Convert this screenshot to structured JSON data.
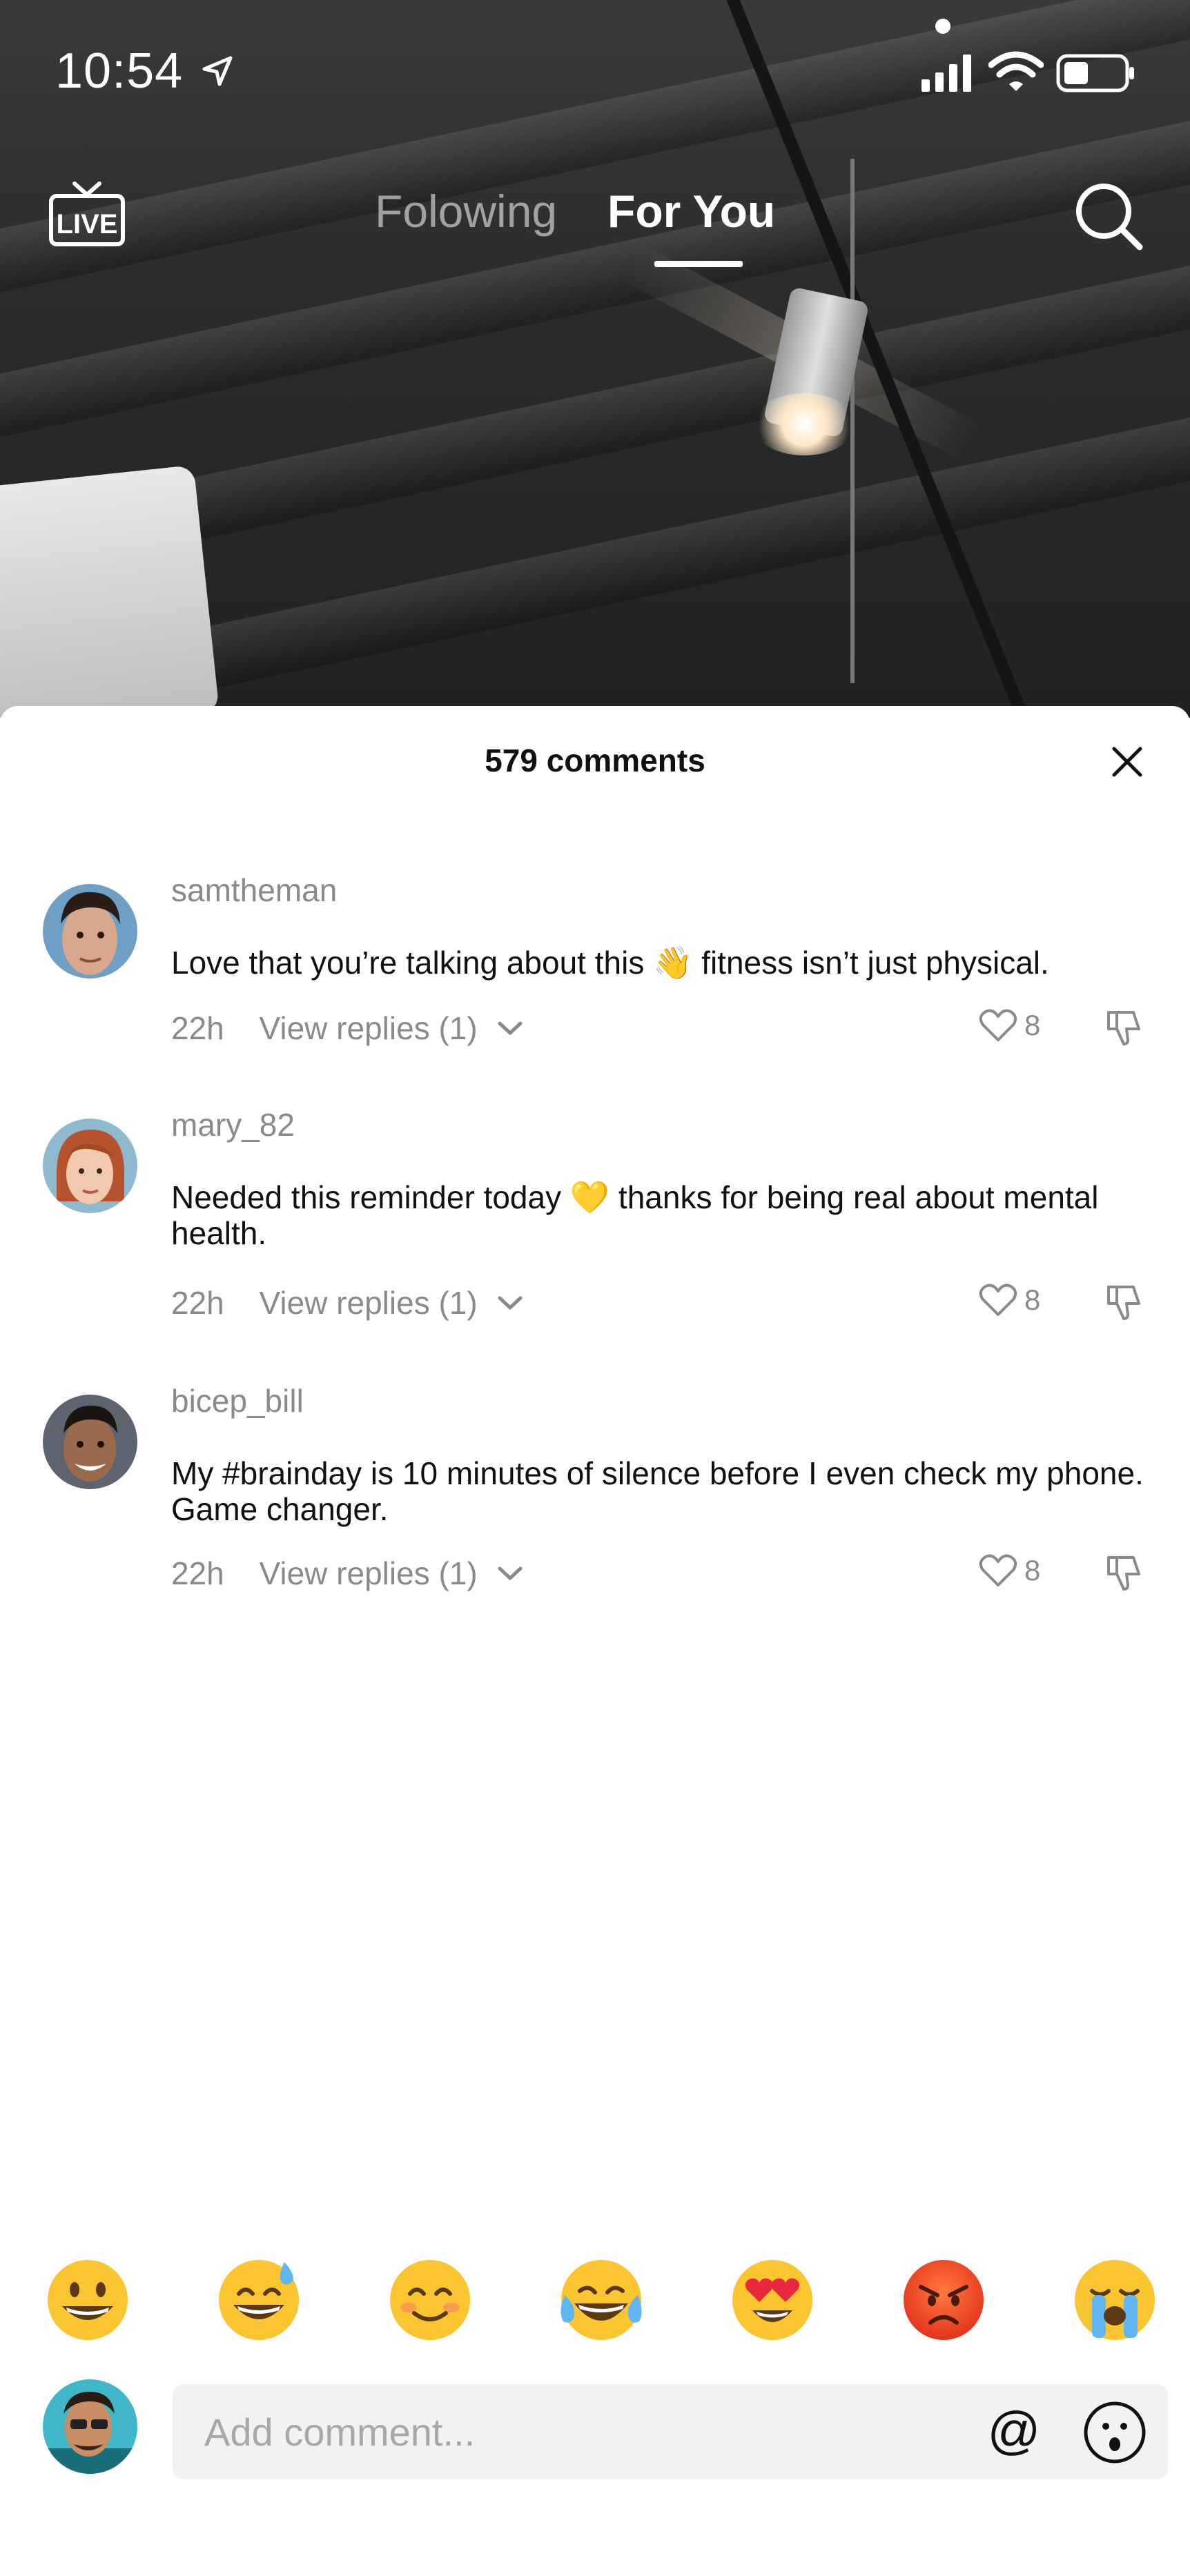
{
  "status_bar": {
    "time": "10:54"
  },
  "top_nav": {
    "live_label": "LIVE",
    "tabs": [
      {
        "label": "Folowing",
        "active": false
      },
      {
        "label": "For You",
        "active": true
      }
    ]
  },
  "comments_sheet": {
    "title": "579 comments",
    "comments": [
      {
        "username": "samtheman",
        "text": "Love that you’re talking about this 👋 fitness isn’t just physical.",
        "time": "22h",
        "replies_label": "View replies (1)",
        "likes": "8"
      },
      {
        "username": "mary_82",
        "text": "Needed this reminder today 💛 thanks for being real about mental health.",
        "time": "22h",
        "replies_label": "View replies (1)",
        "likes": "8"
      },
      {
        "username": "bicep_bill",
        "text": "My #brainday is 10 minutes of silence before I even check my phone. Game changer.",
        "time": "22h",
        "replies_label": "View replies (1)",
        "likes": "8"
      }
    ]
  },
  "emoji_bar": [
    "😀",
    "😅",
    "😊",
    "😂",
    "😍",
    "😡",
    "😭"
  ],
  "composer": {
    "placeholder": "Add comment...",
    "at_symbol": "@"
  },
  "colors": {
    "sheet_bg": "#ffffff",
    "muted_text": "#8a8a8a",
    "input_bg": "#f2f2f3"
  }
}
